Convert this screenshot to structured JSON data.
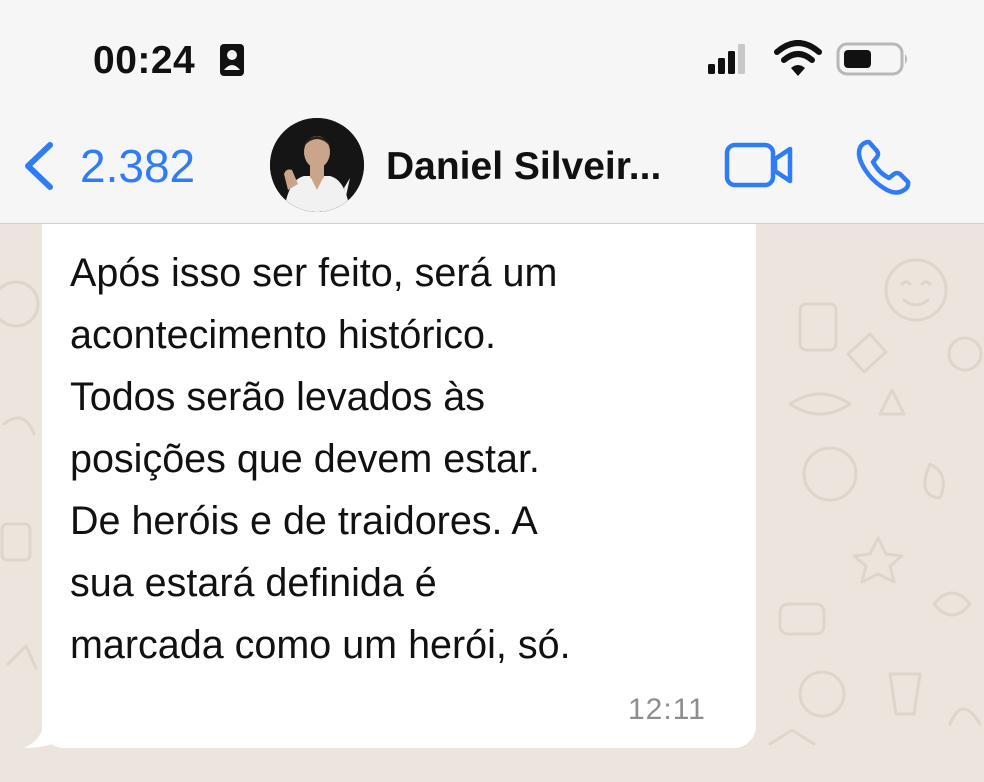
{
  "status_bar": {
    "time": "00:24",
    "icons": [
      "id-badge-icon",
      "signal-icon",
      "wifi-icon",
      "battery-icon"
    ]
  },
  "header": {
    "back_count": "2.382",
    "contact_name": "Daniel Silveir...",
    "icons": [
      "back-chevron-icon",
      "video-camera-icon",
      "phone-icon"
    ]
  },
  "message": {
    "lines": [
      "Após isso ser feito, será um",
      "acontecimento histórico.",
      "Todos serão levados às",
      "posições que devem estar.",
      "De heróis e de traidores. A",
      "sua estará definida é",
      "marcada como um herói, só."
    ],
    "time": "12:11"
  },
  "colors": {
    "accent": "#2f7cf6",
    "header_bg": "#f6f6f6",
    "chat_bg": "#ece5dd",
    "bubble_bg": "#ffffff",
    "timestamp": "#8e8e8e"
  }
}
